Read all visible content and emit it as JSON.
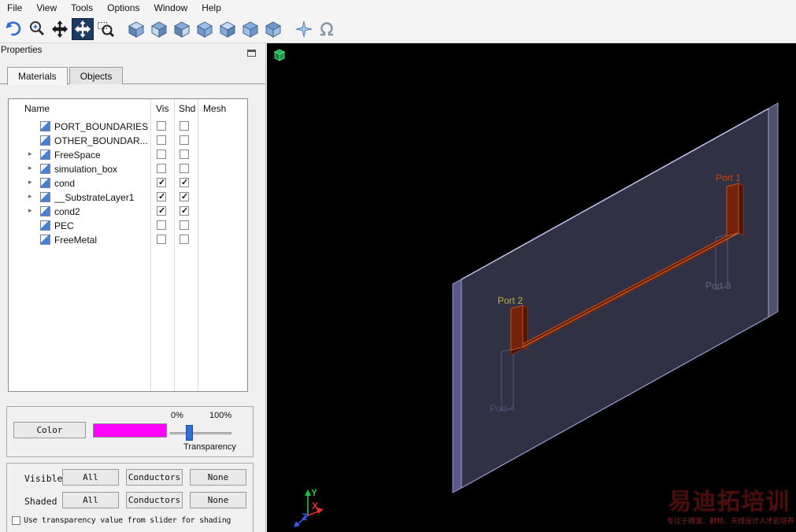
{
  "menu": {
    "items": [
      "File",
      "View",
      "Tools",
      "Options",
      "Window",
      "Help"
    ]
  },
  "toolbar": {
    "icons": [
      "rotate-view",
      "zoom-at-cursor",
      "pan-view",
      "move-tool-active",
      "zoom-window",
      "view-cube-1",
      "view-cube-2",
      "view-cube-3",
      "view-cube-4",
      "view-cube-5",
      "view-cube-6",
      "view-cube-7",
      "axes-star",
      "snap-magnet"
    ]
  },
  "properties_panel": {
    "title": "Properties",
    "tabs": [
      {
        "label": "Materials"
      },
      {
        "label": "Objects"
      }
    ],
    "table": {
      "columns": [
        "Name",
        "Vis",
        "Shd",
        "Mesh"
      ],
      "rows": [
        {
          "name": "PORT_BOUNDARIES",
          "expand": false,
          "vis": false,
          "shd": false
        },
        {
          "name": "OTHER_BOUNDAR...",
          "expand": false,
          "vis": false,
          "shd": false
        },
        {
          "name": "FreeSpace",
          "expand": true,
          "vis": false,
          "shd": false
        },
        {
          "name": "simulation_box",
          "expand": true,
          "vis": false,
          "shd": false
        },
        {
          "name": "cond",
          "expand": true,
          "vis": true,
          "shd": true
        },
        {
          "name": "__SubstrateLayer1",
          "expand": true,
          "vis": true,
          "shd": true
        },
        {
          "name": "cond2",
          "expand": true,
          "vis": true,
          "shd": true
        },
        {
          "name": "PEC",
          "expand": false,
          "vis": false,
          "shd": false
        },
        {
          "name": "FreeMetal",
          "expand": false,
          "vis": false,
          "shd": false
        }
      ]
    },
    "color_section": {
      "color_button": "Color",
      "swatch_color": "#ff00ff",
      "slider": {
        "min_label": "0%",
        "max_label": "100%",
        "caption": "Transparency",
        "value_percent": 30,
        "handle_color": "#2f6fd0"
      }
    },
    "visibility_section": {
      "rows": [
        {
          "label": "Visible",
          "buttons": [
            "All",
            "Conductors",
            "None"
          ]
        },
        {
          "label": "Shaded",
          "buttons": [
            "All",
            "Conductors",
            "None"
          ]
        }
      ],
      "checkbox_label": "Use transparency value from slider for shading",
      "checkbox_checked": false
    }
  },
  "viewport": {
    "background": "#000000",
    "substrate_color": "#8080b8",
    "trace_color": "#74230a",
    "ports": [
      {
        "label": "Port 1",
        "color": "#c2490e"
      },
      {
        "label": "Port 2",
        "color": "#b4b43a"
      },
      {
        "label": "Port 3",
        "color": "#63637a"
      },
      {
        "label": "Port 4",
        "color": "#4e4e6e"
      }
    ],
    "axes": [
      {
        "label": "Y",
        "color": "#18c838"
      },
      {
        "label": "X",
        "color": "#e83030"
      },
      {
        "label": "Z",
        "color": "#3858f0"
      }
    ],
    "watermark": {
      "line1": "易迪拓培训",
      "line2": "专注于微波、射频、天线设计人才的培养",
      "color": "#b01212"
    }
  }
}
